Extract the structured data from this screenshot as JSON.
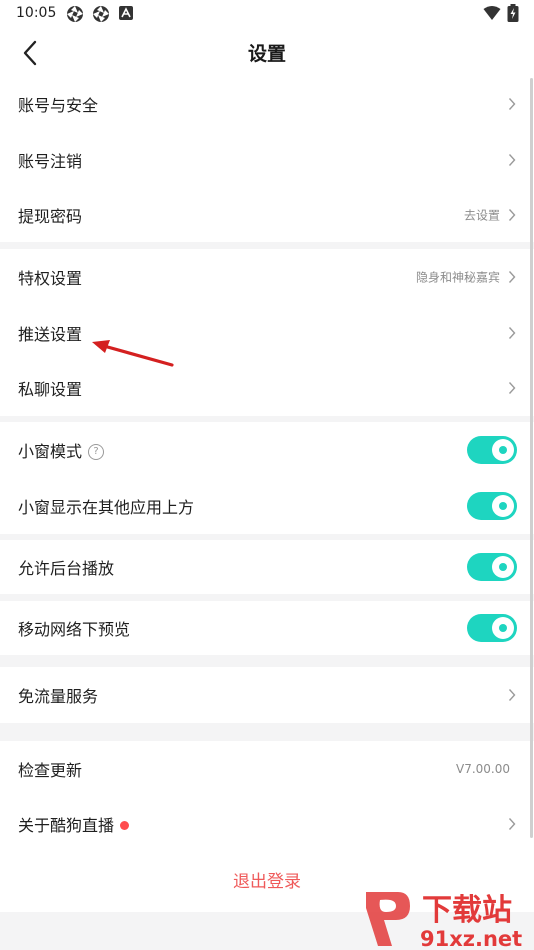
{
  "status_bar": {
    "time": "10:05",
    "left_icons": [
      "aperture-icon",
      "aperture-icon",
      "a-app-icon"
    ],
    "right_icons": [
      "wifi-icon",
      "battery-charging-icon"
    ]
  },
  "header": {
    "title": "设置",
    "back_icon": "chevron-left-icon"
  },
  "sections": {
    "account": {
      "security": {
        "label": "账号与安全"
      },
      "cancel": {
        "label": "账号注销"
      },
      "withdraw": {
        "label": "提现密码",
        "hint": "去设置"
      }
    },
    "settings": {
      "privilege": {
        "label": "特权设置",
        "hint": "隐身和神秘嘉宾"
      },
      "push": {
        "label": "推送设置"
      },
      "private_chat": {
        "label": "私聊设置"
      }
    },
    "window": {
      "small_window": {
        "label": "小窗模式",
        "help_icon": "help-circle-icon",
        "on": true
      },
      "overlay": {
        "label": "小窗显示在其他应用上方",
        "on": true
      }
    },
    "background": {
      "bg_play": {
        "label": "允许后台播放",
        "on": true
      }
    },
    "mobile": {
      "preview": {
        "label": "移动网络下预览",
        "on": true
      }
    },
    "traffic": {
      "free": {
        "label": "免流量服务"
      }
    },
    "about": {
      "update": {
        "label": "检查更新",
        "version": "V7.00.00"
      },
      "about_app": {
        "label": "关于酷狗直播",
        "badge": "red-dot"
      }
    }
  },
  "logout": {
    "label": "退出登录"
  },
  "annotation": {
    "type": "red-arrow",
    "points_to": "推送设置"
  },
  "watermark": {
    "brand": "下载站",
    "site": "91xz.net",
    "logo_text": "91"
  },
  "colors": {
    "accent": "#1ed5c0",
    "logout": "#ef5a5a",
    "badge": "#ff4d4f",
    "arrow": "#d42020",
    "watermark": "#e23a3a"
  }
}
